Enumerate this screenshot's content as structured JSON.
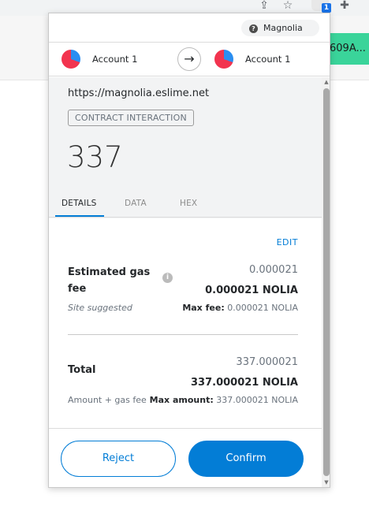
{
  "background": {
    "pill_text": "609A..."
  },
  "browser": {
    "ext_badge": "1"
  },
  "network": {
    "name": "Magnolia",
    "icon": "question-icon",
    "icon_glyph": "?"
  },
  "accounts": {
    "from": "Account 1",
    "to": "Account 1",
    "arrow_glyph": "→"
  },
  "summary": {
    "origin": "https://magnolia.eslime.net",
    "badge": "CONTRACT INTERACTION",
    "amount": "337"
  },
  "tabs": [
    {
      "label": "DETAILS",
      "active": true
    },
    {
      "label": "DATA",
      "active": false
    },
    {
      "label": "HEX",
      "active": false
    }
  ],
  "details": {
    "edit": "EDIT",
    "gas": {
      "label": "Estimated gas fee",
      "info_glyph": "i",
      "value": "0.000021",
      "value_bold": "0.000021 NOLIA",
      "note": "Site suggested",
      "max_label": "Max fee:",
      "max_value": "0.000021 NOLIA"
    },
    "total": {
      "label": "Total",
      "value": "337.000021",
      "value_bold": "337.000021 NOLIA",
      "note": "Amount + gas fee",
      "max_label": "Max amount:",
      "max_value": "337.000021 NOLIA"
    }
  },
  "footer": {
    "reject": "Reject",
    "confirm": "Confirm"
  },
  "colors": {
    "accent": "#037dd6",
    "summary_bg": "#f2f3f4",
    "bg_pill": "#3ad49a"
  }
}
